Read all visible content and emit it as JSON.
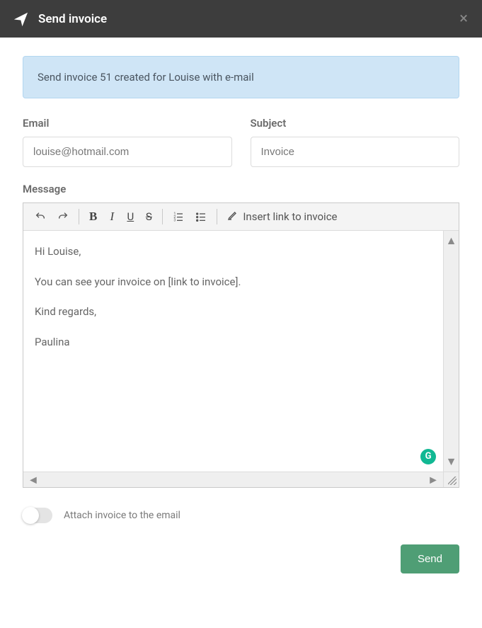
{
  "header": {
    "title": "Send invoice"
  },
  "info_banner": "Send invoice 51 created for Louise with e-mail",
  "form": {
    "email": {
      "label": "Email",
      "value": "louise@hotmail.com"
    },
    "subject": {
      "label": "Subject",
      "value": "Invoice"
    }
  },
  "message": {
    "label": "Message",
    "paragraphs": [
      "Hi Louise,",
      "You can see your invoice on [link to invoice].",
      "Kind regards,",
      "Paulina"
    ]
  },
  "toolbar": {
    "insert_link_label": "Insert link to invoice"
  },
  "attach": {
    "label": "Attach invoice to the email",
    "value": false
  },
  "buttons": {
    "send": "Send"
  },
  "icons": {
    "grammarly_glyph": "G"
  }
}
